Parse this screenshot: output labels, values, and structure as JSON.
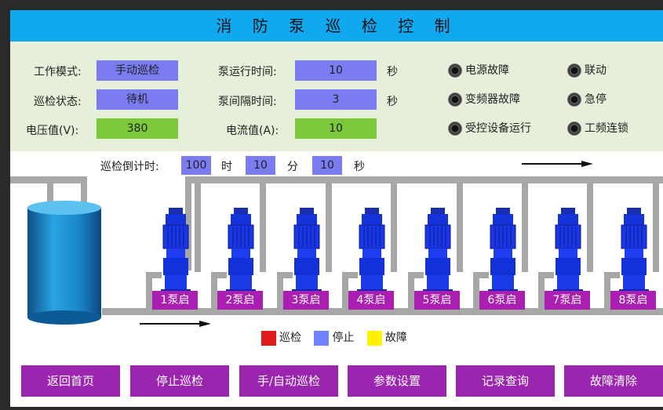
{
  "title": "消 防 泵 巡 检 控 制",
  "fields": {
    "work_mode_label": "工作模式:",
    "work_mode_value": "手动巡检",
    "inspect_state_label": "巡检状态:",
    "inspect_state_value": "待机",
    "voltage_label": "电压值(V):",
    "voltage_value": "380",
    "pump_run_time_label": "泵运行时间:",
    "pump_run_time_value": "10",
    "pump_run_time_unit": "秒",
    "pump_interval_label": "泵间隔时间:",
    "pump_interval_value": "3",
    "pump_interval_unit": "秒",
    "current_label": "电流值(A):",
    "current_value": "10"
  },
  "indicators": [
    {
      "label": "电源故障"
    },
    {
      "label": "联动"
    },
    {
      "label": "变频器故障"
    },
    {
      "label": "急停"
    },
    {
      "label": "受控设备运行"
    },
    {
      "label": "工频连锁"
    }
  ],
  "countdown": {
    "label": "巡检倒计时:",
    "hours": "100",
    "hours_unit": "时",
    "minutes": "10",
    "minutes_unit": "分",
    "seconds": "10",
    "seconds_unit": "秒"
  },
  "pumps": [
    "1泵启",
    "2泵启",
    "3泵启",
    "4泵启",
    "5泵启",
    "6泵启",
    "7泵启",
    "8泵启"
  ],
  "legend": [
    {
      "label": "巡检",
      "color": "#e01b1b"
    },
    {
      "label": "停止",
      "color": "#6f82ff"
    },
    {
      "label": "故障",
      "color": "#fff200"
    }
  ],
  "buttons": [
    "返回首页",
    "停止巡检",
    "手/自动巡检",
    "参数设置",
    "记录查询",
    "故障清除"
  ],
  "colors": {
    "title_bar": "#10a9ef",
    "info_panel": "#e5efd9",
    "value_box_blue": "#7b7bf2",
    "value_box_green": "#7cc83a",
    "button_purple": "#9b25af",
    "pump_label_purple": "#aa1eb2",
    "pipe_gray": "#a7a7a7",
    "pump_blue": "#1530e0",
    "tank_blue": "#1f8fd0"
  }
}
